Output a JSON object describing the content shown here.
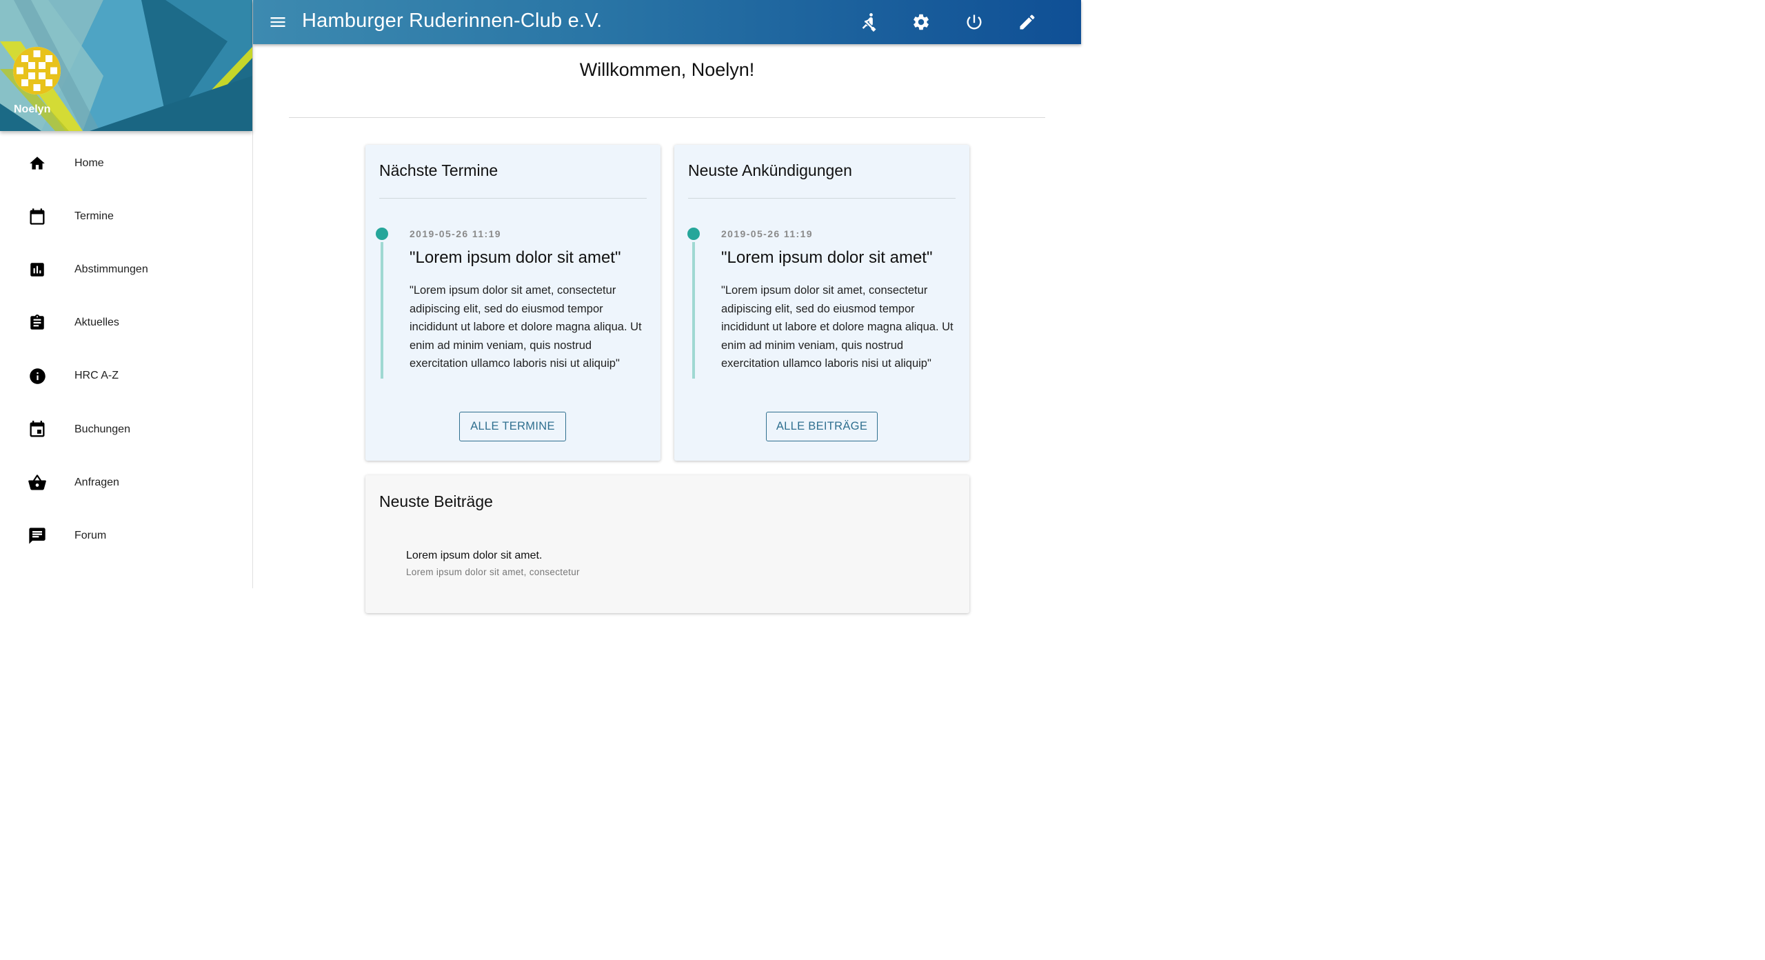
{
  "app": {
    "title": "Hamburger Ruderinnen-Club e.V."
  },
  "user": {
    "name": "Noelyn"
  },
  "sidebar": {
    "items": [
      {
        "label": "Home",
        "icon": "home-icon"
      },
      {
        "label": "Termine",
        "icon": "calendar-icon"
      },
      {
        "label": "Abstimmungen",
        "icon": "poll-icon"
      },
      {
        "label": "Aktuelles",
        "icon": "clipboard-icon"
      },
      {
        "label": "HRC A-Z",
        "icon": "info-icon"
      },
      {
        "label": "Buchungen",
        "icon": "event-icon"
      },
      {
        "label": "Anfragen",
        "icon": "basket-icon"
      },
      {
        "label": "Forum",
        "icon": "chat-icon"
      }
    ]
  },
  "toolbar": {
    "icons": [
      "rowing-icon",
      "gear-icon",
      "power-icon",
      "pencil-icon"
    ]
  },
  "main": {
    "welcome": "Willkommen, Noelyn!",
    "termine": {
      "title": "Nächste Termine",
      "date": "2019-05-26 11:19",
      "headline": "\"Lorem ipsum dolor sit amet\"",
      "body": "\"Lorem ipsum dolor sit amet, consectetur adipiscing elit, sed do eiusmod tempor incididunt ut labore et dolore magna aliqua. Ut enim ad minim veniam, quis nostrud exercitation ullamco laboris nisi ut aliquip\"",
      "button": "ALLE TERMINE"
    },
    "ankuendigungen": {
      "title": "Neuste Ankündigungen",
      "date": "2019-05-26 11:19",
      "headline": "\"Lorem ipsum dolor sit amet\"",
      "body": "\"Lorem ipsum dolor sit amet, consectetur adipiscing elit, sed do eiusmod tempor incididunt ut labore et dolore magna aliqua. Ut enim ad minim veniam, quis nostrud exercitation ullamco laboris nisi ut aliquip\"",
      "button": "ALLE BEITRÄGE"
    },
    "beitraege": {
      "title": "Neuste Beiträge",
      "post_title": "Lorem ipsum dolor sit amet.",
      "post_sub": "Lorem ipsum dolor sit amet, consectetur"
    }
  },
  "colors": {
    "accent": "#26a69a",
    "button_text": "#2f6f8f",
    "topbar_start": "#3d8ab0",
    "topbar_end": "#0f4f95"
  }
}
